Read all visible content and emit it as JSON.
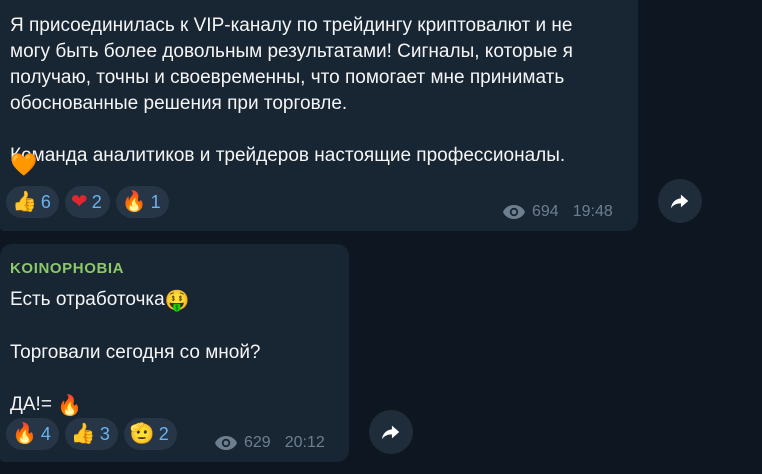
{
  "messages": [
    {
      "text_lines": [
        "Я присоединилась к VIP-каналу по трейдингу криптовалют и не",
        "могу быть более довольным результатами! Сигналы, которые я",
        "получаю, точны и своевременны, что помогает мне принимать",
        "обоснованные решения при торговле.",
        "",
        "Команда аналитиков и трейдеров настоящие профессионалы."
      ],
      "trailing_emoji": "🧡",
      "reactions": [
        {
          "emoji": "👍",
          "count": "6"
        },
        {
          "emoji": "❤",
          "count": "2"
        },
        {
          "emoji": "🔥",
          "count": "1"
        }
      ],
      "views": "694",
      "time": "19:48"
    },
    {
      "author": "KOINOPHOBIA",
      "line1": "Есть отработочка",
      "line1_emoji": "🤑",
      "line2": "Торговали сегодня со мной?",
      "line3": "ДА!=",
      "line3_emoji": "🔥",
      "reactions": [
        {
          "emoji": "🔥",
          "count": "4"
        },
        {
          "emoji": "👍",
          "count": "3"
        },
        {
          "emoji": "🫡",
          "count": "2"
        }
      ],
      "views": "629",
      "time": "20:12"
    }
  ],
  "colors": {
    "background": "#0e1621",
    "bubble": "#182533",
    "author": "#8cc76a",
    "reaction_count": "#6ab2f2",
    "meta": "#6d7f8f"
  },
  "icons": {
    "views": "eye-icon",
    "forward": "forward-arrow-icon"
  }
}
